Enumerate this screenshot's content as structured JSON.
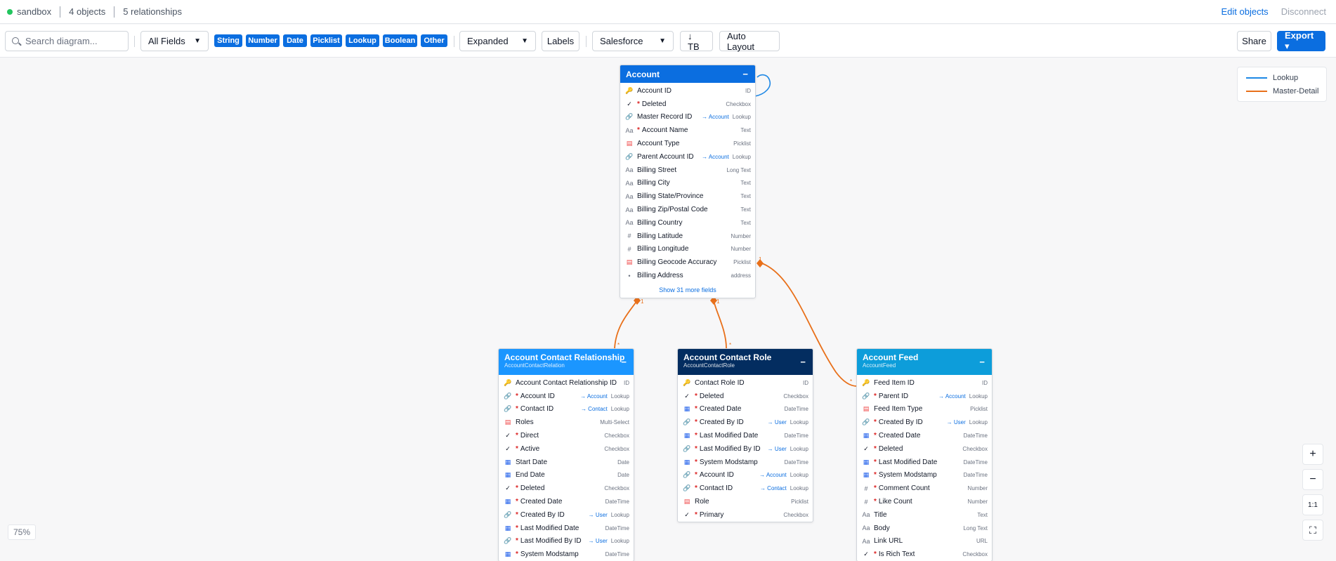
{
  "topbar": {
    "env": "sandbox",
    "objects": "4 objects",
    "relationships": "5 relationships",
    "edit_objects": "Edit objects",
    "disconnect": "Disconnect"
  },
  "toolbar": {
    "search_placeholder": "Search diagram...",
    "fields_select": "All Fields",
    "chips": [
      "String",
      "Number",
      "Date",
      "Picklist",
      "Lookup",
      "Boolean",
      "Other"
    ],
    "view_select": "Expanded",
    "labels": "Labels",
    "style_select": "Salesforce",
    "direction": "↓ TB",
    "auto_layout": "Auto Layout",
    "share": "Share",
    "export": "Export ▾"
  },
  "legend": {
    "lookup": "Lookup",
    "master_detail": "Master-Detail",
    "lookup_color": "#1e88e5",
    "master_detail_color": "#e8701a"
  },
  "zoom": {
    "level": "75%",
    "in": "+",
    "out": "−",
    "reset": "1:1",
    "fit": "⛶"
  },
  "cards": {
    "account": {
      "title": "Account",
      "color": "#0b6ee0",
      "minimize": "−",
      "fields": [
        {
          "icon": "key",
          "req": false,
          "name": "Account ID",
          "ref": "",
          "type": "ID"
        },
        {
          "icon": "chk",
          "req": true,
          "name": "Deleted",
          "ref": "",
          "type": "Checkbox"
        },
        {
          "icon": "link",
          "req": false,
          "name": "Master Record ID",
          "ref": "→ Account",
          "type": "Lookup"
        },
        {
          "icon": "text",
          "req": true,
          "name": "Account Name",
          "ref": "",
          "type": "Text"
        },
        {
          "icon": "pick",
          "req": false,
          "name": "Account Type",
          "ref": "",
          "type": "Picklist"
        },
        {
          "icon": "link",
          "req": false,
          "name": "Parent Account ID",
          "ref": "→ Account",
          "type": "Lookup"
        },
        {
          "icon": "text",
          "req": false,
          "name": "Billing Street",
          "ref": "",
          "type": "Long Text"
        },
        {
          "icon": "text",
          "req": false,
          "name": "Billing City",
          "ref": "",
          "type": "Text"
        },
        {
          "icon": "text",
          "req": false,
          "name": "Billing State/Province",
          "ref": "",
          "type": "Text"
        },
        {
          "icon": "text",
          "req": false,
          "name": "Billing Zip/Postal Code",
          "ref": "",
          "type": "Text"
        },
        {
          "icon": "text",
          "req": false,
          "name": "Billing Country",
          "ref": "",
          "type": "Text"
        },
        {
          "icon": "num",
          "req": false,
          "name": "Billing Latitude",
          "ref": "",
          "type": "Number"
        },
        {
          "icon": "num",
          "req": false,
          "name": "Billing Longitude",
          "ref": "",
          "type": "Number"
        },
        {
          "icon": "pick",
          "req": false,
          "name": "Billing Geocode Accuracy",
          "ref": "",
          "type": "Picklist"
        },
        {
          "icon": "dot",
          "req": false,
          "name": "Billing Address",
          "ref": "",
          "type": "address"
        }
      ],
      "show_more": "Show 31 more fields"
    },
    "acr": {
      "title": "Account Contact Relationship",
      "subtitle": "AccountContactRelation",
      "color": "#1b96ff",
      "minimize": "−",
      "fields": [
        {
          "icon": "key",
          "req": false,
          "name": "Account Contact Relationship ID",
          "ref": "",
          "type": "ID"
        },
        {
          "icon": "link",
          "req": true,
          "name": "Account ID",
          "ref": "→ Account",
          "type": "Lookup"
        },
        {
          "icon": "link",
          "req": true,
          "name": "Contact ID",
          "ref": "→ Contact",
          "type": "Lookup"
        },
        {
          "icon": "pick",
          "req": false,
          "name": "Roles",
          "ref": "",
          "type": "Multi-Select"
        },
        {
          "icon": "chk",
          "req": true,
          "name": "Direct",
          "ref": "",
          "type": "Checkbox"
        },
        {
          "icon": "chk",
          "req": true,
          "name": "Active",
          "ref": "",
          "type": "Checkbox"
        },
        {
          "icon": "cal",
          "req": false,
          "name": "Start Date",
          "ref": "",
          "type": "Date"
        },
        {
          "icon": "cal",
          "req": false,
          "name": "End Date",
          "ref": "",
          "type": "Date"
        },
        {
          "icon": "chk",
          "req": true,
          "name": "Deleted",
          "ref": "",
          "type": "Checkbox"
        },
        {
          "icon": "cal",
          "req": true,
          "name": "Created Date",
          "ref": "",
          "type": "DateTime"
        },
        {
          "icon": "link",
          "req": true,
          "name": "Created By ID",
          "ref": "→ User",
          "type": "Lookup"
        },
        {
          "icon": "cal",
          "req": true,
          "name": "Last Modified Date",
          "ref": "",
          "type": "DateTime"
        },
        {
          "icon": "link",
          "req": true,
          "name": "Last Modified By ID",
          "ref": "→ User",
          "type": "Lookup"
        },
        {
          "icon": "cal",
          "req": true,
          "name": "System Modstamp",
          "ref": "",
          "type": "DateTime"
        }
      ]
    },
    "acrole": {
      "title": "Account Contact Role",
      "subtitle": "AccountContactRole",
      "color": "#032d60",
      "minimize": "−",
      "fields": [
        {
          "icon": "key",
          "req": false,
          "name": "Contact Role ID",
          "ref": "",
          "type": "ID"
        },
        {
          "icon": "chk",
          "req": true,
          "name": "Deleted",
          "ref": "",
          "type": "Checkbox"
        },
        {
          "icon": "cal",
          "req": true,
          "name": "Created Date",
          "ref": "",
          "type": "DateTime"
        },
        {
          "icon": "link",
          "req": true,
          "name": "Created By ID",
          "ref": "→ User",
          "type": "Lookup"
        },
        {
          "icon": "cal",
          "req": true,
          "name": "Last Modified Date",
          "ref": "",
          "type": "DateTime"
        },
        {
          "icon": "link",
          "req": true,
          "name": "Last Modified By ID",
          "ref": "→ User",
          "type": "Lookup"
        },
        {
          "icon": "cal",
          "req": true,
          "name": "System Modstamp",
          "ref": "",
          "type": "DateTime"
        },
        {
          "icon": "link",
          "req": true,
          "name": "Account ID",
          "ref": "→ Account",
          "type": "Lookup"
        },
        {
          "icon": "link",
          "req": true,
          "name": "Contact ID",
          "ref": "→ Contact",
          "type": "Lookup"
        },
        {
          "icon": "pick",
          "req": false,
          "name": "Role",
          "ref": "",
          "type": "Picklist"
        },
        {
          "icon": "chk",
          "req": true,
          "name": "Primary",
          "ref": "",
          "type": "Checkbox"
        }
      ]
    },
    "feed": {
      "title": "Account Feed",
      "subtitle": "AccountFeed",
      "color": "#0d9dda",
      "minimize": "−",
      "fields": [
        {
          "icon": "key",
          "req": false,
          "name": "Feed Item ID",
          "ref": "",
          "type": "ID"
        },
        {
          "icon": "link",
          "req": true,
          "name": "Parent ID",
          "ref": "→ Account",
          "type": "Lookup"
        },
        {
          "icon": "pick",
          "req": false,
          "name": "Feed Item Type",
          "ref": "",
          "type": "Picklist"
        },
        {
          "icon": "link",
          "req": true,
          "name": "Created By ID",
          "ref": "→ User",
          "type": "Lookup"
        },
        {
          "icon": "cal",
          "req": true,
          "name": "Created Date",
          "ref": "",
          "type": "DateTime"
        },
        {
          "icon": "chk",
          "req": true,
          "name": "Deleted",
          "ref": "",
          "type": "Checkbox"
        },
        {
          "icon": "cal",
          "req": true,
          "name": "Last Modified Date",
          "ref": "",
          "type": "DateTime"
        },
        {
          "icon": "cal",
          "req": true,
          "name": "System Modstamp",
          "ref": "",
          "type": "DateTime"
        },
        {
          "icon": "num",
          "req": true,
          "name": "Comment Count",
          "ref": "",
          "type": "Number"
        },
        {
          "icon": "num",
          "req": true,
          "name": "Like Count",
          "ref": "",
          "type": "Number"
        },
        {
          "icon": "text",
          "req": false,
          "name": "Title",
          "ref": "",
          "type": "Text"
        },
        {
          "icon": "text",
          "req": false,
          "name": "Body",
          "ref": "",
          "type": "Long Text"
        },
        {
          "icon": "text",
          "req": false,
          "name": "Link URL",
          "ref": "",
          "type": "URL"
        },
        {
          "icon": "chk",
          "req": true,
          "name": "Is Rich Text",
          "ref": "",
          "type": "Checkbox"
        }
      ]
    }
  },
  "edge_labels": {
    "one": "1",
    "many": "*"
  }
}
